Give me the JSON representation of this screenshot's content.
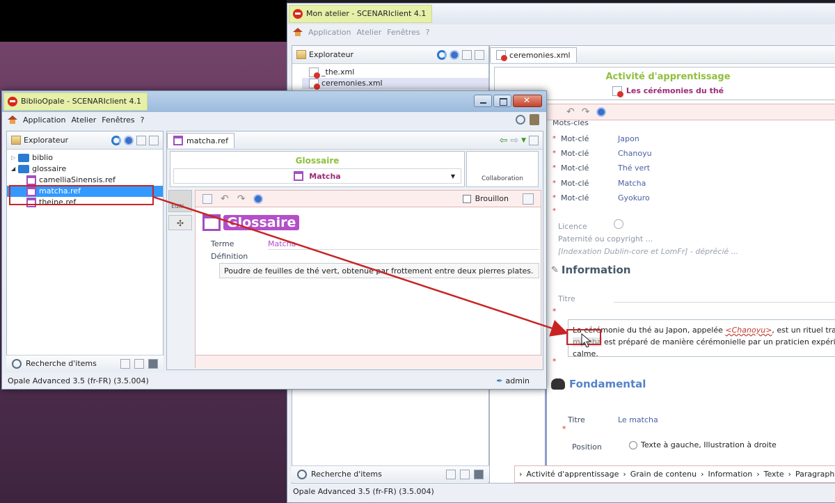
{
  "back_window": {
    "title": "Mon atelier - SCENARIclient 4.1",
    "menu": [
      "Application",
      "Atelier",
      "Fenêtres",
      "?"
    ],
    "explorer": {
      "header": "Explorateur",
      "files": [
        "_the.xml",
        "ceremonies.xml"
      ]
    },
    "editor_tab": "ceremonies.xml",
    "doc": {
      "type_title": "Activité d'apprentissage",
      "doc_title": "Les cérémonies du thé",
      "keywords_heading": "Mots-clés",
      "keywords": [
        {
          "label": "Mot-clé",
          "value": "Japon"
        },
        {
          "label": "Mot-clé",
          "value": "Chanoyu"
        },
        {
          "label": "Mot-clé",
          "value": "Thé vert"
        },
        {
          "label": "Mot-clé",
          "value": "Matcha"
        },
        {
          "label": "Mot-clé",
          "value": "Gyokuro"
        }
      ],
      "licence_label": "Licence",
      "paternity_label": "Paternité ou copyright ...",
      "indexation_label": "[Indexation Dublin-core et LomFr] - déprécié ...",
      "information_title": "Information",
      "titre_label": "Titre",
      "paragraph_line1_a": "La cérémonie du thé au Japon, appelée ",
      "paragraph_line1_link": "<Chanoyu>",
      "paragraph_line1_b": ", est un rituel traditionn",
      "paragraph_line2_drop": "matcha",
      "paragraph_line2": " est préparé de manière cérémonielle par un praticien expérimenté",
      "paragraph_line3": "calme.",
      "fondamental_title": "Fondamental",
      "fondamental_titre_label": "Titre",
      "fondamental_titre_value": "Le matcha",
      "position_label": "Position",
      "position_value": "Texte à gauche, Illustration à droite"
    },
    "search_label": "Recherche d'items",
    "breadcrumb": [
      "Activité d'apprentissage",
      "Grain de contenu",
      "Information",
      "Texte",
      "Paragraphe"
    ],
    "status": "Opale Advanced 3.5 (fr-FR) (3.5.004)"
  },
  "front_window": {
    "title": "BiblioOpale - SCENARIclient 4.1",
    "menu": [
      "Application",
      "Atelier",
      "Fenêtres",
      "?"
    ],
    "explorer": {
      "header": "Explorateur",
      "items": [
        {
          "label": "biblio",
          "kind": "folder"
        },
        {
          "label": "glossaire",
          "kind": "folder"
        },
        {
          "label": "camelliaSinensis.ref",
          "kind": "ref"
        },
        {
          "label": "matcha.ref",
          "kind": "ref",
          "selected": true
        },
        {
          "label": "theine.ref",
          "kind": "ref"
        }
      ]
    },
    "editor_tab": "matcha.ref",
    "glossary": {
      "type_title": "Glossaire",
      "item_title": "Matcha",
      "collaboration": "Collaboration",
      "draft_label": "Brouillon",
      "side_tab_edit": "Editi...",
      "badge": "Glossaire",
      "term_label": "Terme",
      "term_value": "Matcha",
      "definition_label": "Définition",
      "definition_value": "Poudre de feuilles de thé vert, obtenue par frottement entre deux pierres plates."
    },
    "search_label": "Recherche d'items",
    "status": "Opale Advanced 3.5 (fr-FR) (3.5.004)",
    "user": "admin"
  },
  "colors": {
    "accent_green": "#8fbf3f",
    "title_purple": "#9b2b77",
    "glossary_purple": "#b24fc9",
    "selection_red": "#c82424",
    "selection_blue": "#3399ff"
  }
}
